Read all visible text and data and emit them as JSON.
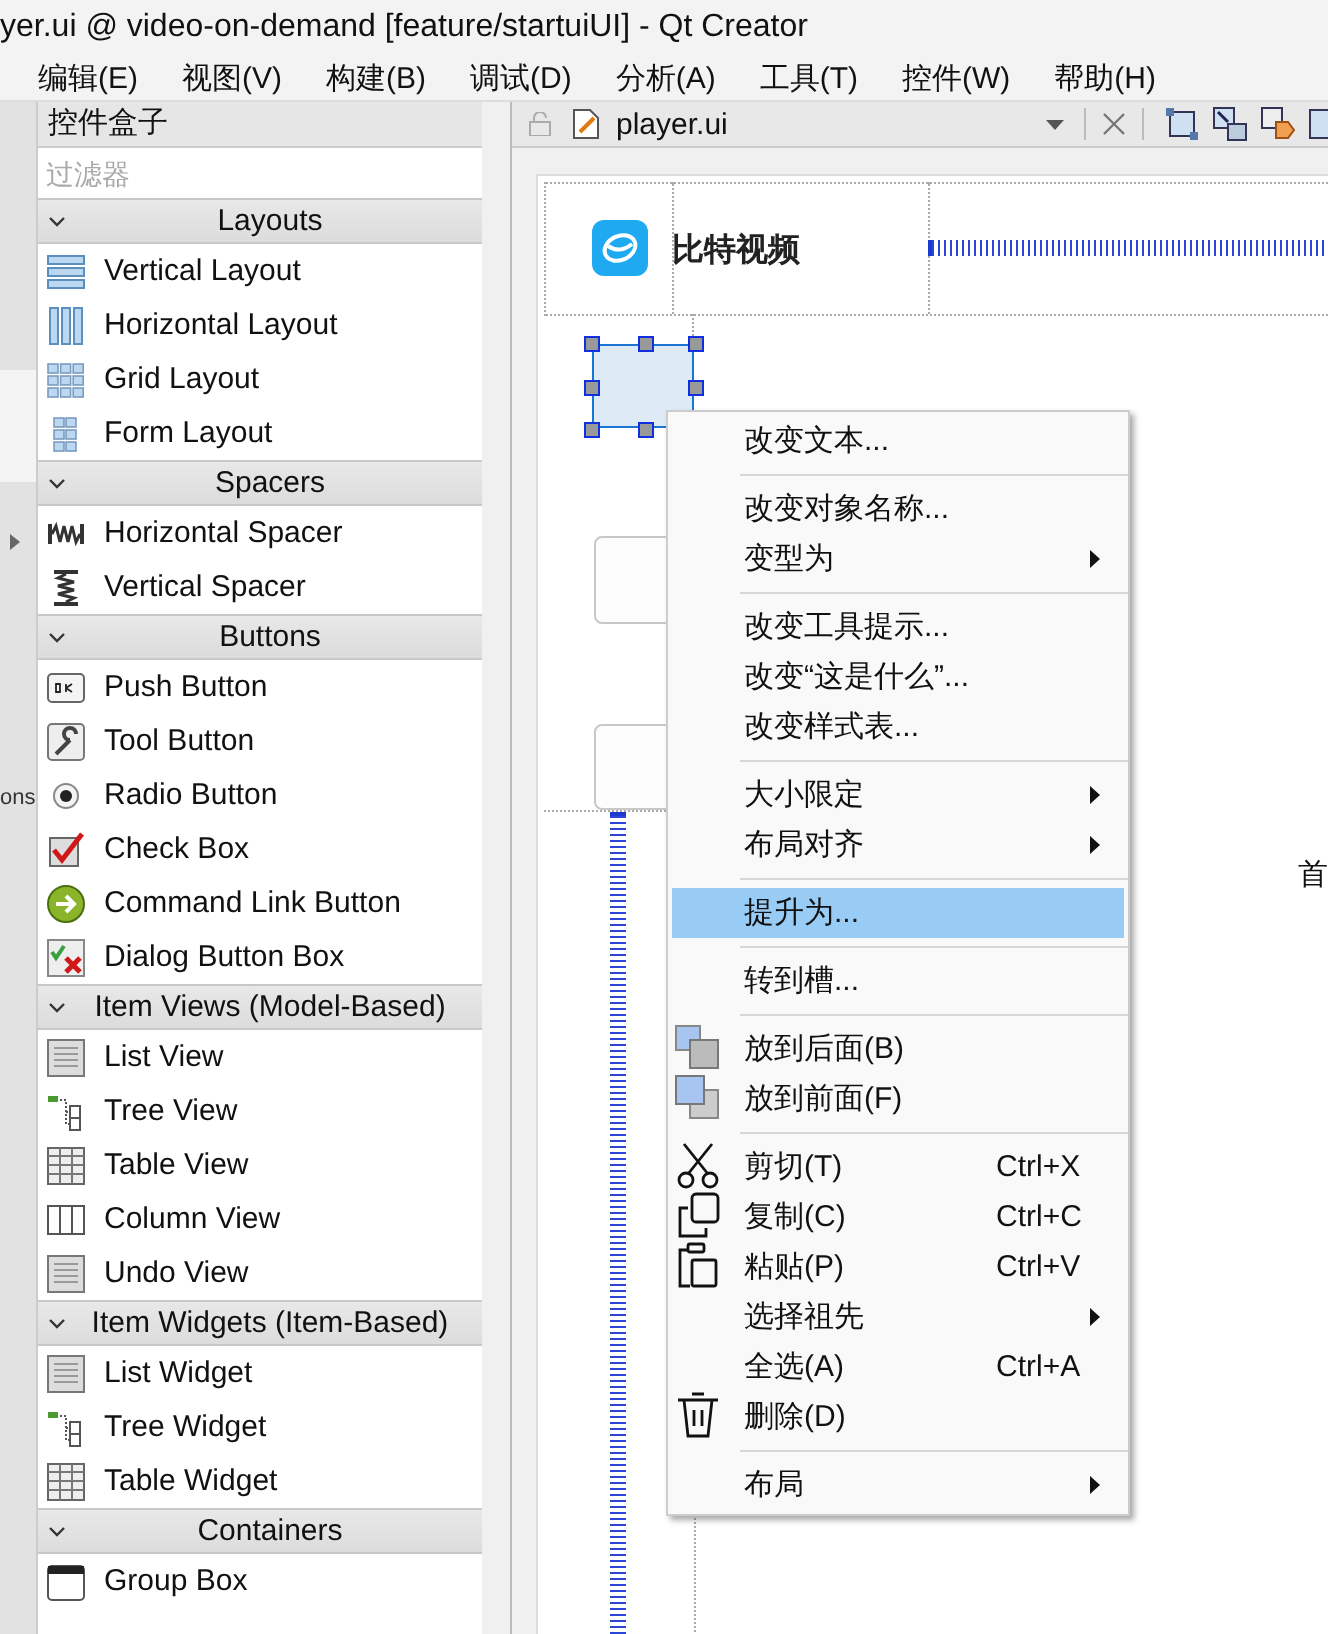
{
  "window": {
    "title": "yer.ui @ video-on-demand [feature/startuiUI] - Qt Creator"
  },
  "menu_bar": [
    "编辑(E)",
    "视图(V)",
    "构建(B)",
    "调试(D)",
    "分析(A)",
    "工具(T)",
    "控件(W)",
    "帮助(H)"
  ],
  "mode_bar": {
    "label": "ons"
  },
  "widget_box": {
    "title": "控件盒子",
    "filter": {
      "placeholder": "过滤器"
    },
    "categories": [
      {
        "title": "Layouts",
        "expanded": true,
        "items": [
          "Vertical Layout",
          "Horizontal Layout",
          "Grid Layout",
          "Form Layout"
        ]
      },
      {
        "title": "Spacers",
        "expanded": true,
        "items": [
          "Horizontal Spacer",
          "Vertical Spacer"
        ]
      },
      {
        "title": "Buttons",
        "expanded": true,
        "items": [
          "Push Button",
          "Tool Button",
          "Radio Button",
          "Check Box",
          "Command Link Button",
          "Dialog Button Box"
        ]
      },
      {
        "title": "Item Views (Model-Based)",
        "expanded": true,
        "items": [
          "List View",
          "Tree View",
          "Table View",
          "Column View",
          "Undo View"
        ]
      },
      {
        "title": "Item Widgets (Item-Based)",
        "expanded": true,
        "items": [
          "List Widget",
          "Tree Widget",
          "Table Widget"
        ]
      },
      {
        "title": "Containers",
        "expanded": true,
        "items": [
          "Group Box"
        ]
      }
    ]
  },
  "editor": {
    "tab": {
      "file": "player.ui"
    },
    "form": {
      "app_name": "比特视频",
      "cut_label": "首"
    }
  },
  "context_menu": {
    "items": [
      {
        "kind": "item",
        "label": "改变文本...",
        "selected": false,
        "submenu": false
      },
      {
        "kind": "separator"
      },
      {
        "kind": "item",
        "label": "改变对象名称...",
        "selected": false,
        "submenu": false
      },
      {
        "kind": "item",
        "label": "变型为",
        "selected": false,
        "submenu": true
      },
      {
        "kind": "separator"
      },
      {
        "kind": "item",
        "label": "改变工具提示...",
        "selected": false,
        "submenu": false
      },
      {
        "kind": "item",
        "label": "改变“这是什么”...",
        "selected": false,
        "submenu": false
      },
      {
        "kind": "item",
        "label": "改变样式表...",
        "selected": false,
        "submenu": false
      },
      {
        "kind": "separator"
      },
      {
        "kind": "item",
        "label": "大小限定",
        "selected": false,
        "submenu": true
      },
      {
        "kind": "item",
        "label": "布局对齐",
        "selected": false,
        "submenu": true
      },
      {
        "kind": "separator"
      },
      {
        "kind": "item",
        "label": "提升为...",
        "selected": true,
        "submenu": false
      },
      {
        "kind": "separator"
      },
      {
        "kind": "item",
        "label": "转到槽...",
        "selected": false,
        "submenu": false
      },
      {
        "kind": "separator"
      },
      {
        "kind": "item",
        "label": "放到后面(B)",
        "selected": false,
        "submenu": false,
        "icon": true
      },
      {
        "kind": "item",
        "label": "放到前面(F)",
        "selected": false,
        "submenu": false,
        "icon": true
      },
      {
        "kind": "separator"
      },
      {
        "kind": "item",
        "label": "剪切(T)",
        "shortcut": "Ctrl+X",
        "selected": false,
        "submenu": false,
        "icon": true
      },
      {
        "kind": "item",
        "label": "复制(C)",
        "shortcut": "Ctrl+C",
        "selected": false,
        "submenu": false,
        "icon": true
      },
      {
        "kind": "item",
        "label": "粘贴(P)",
        "shortcut": "Ctrl+V",
        "selected": false,
        "submenu": false,
        "icon": true
      },
      {
        "kind": "item",
        "label": "选择祖先",
        "selected": false,
        "submenu": true
      },
      {
        "kind": "item",
        "label": "全选(A)",
        "shortcut": "Ctrl+A",
        "selected": false,
        "submenu": false
      },
      {
        "kind": "item",
        "label": "删除(D)",
        "selected": false,
        "submenu": false,
        "icon": true
      },
      {
        "kind": "separator"
      },
      {
        "kind": "item",
        "label": "布局",
        "selected": false,
        "submenu": true
      }
    ]
  }
}
